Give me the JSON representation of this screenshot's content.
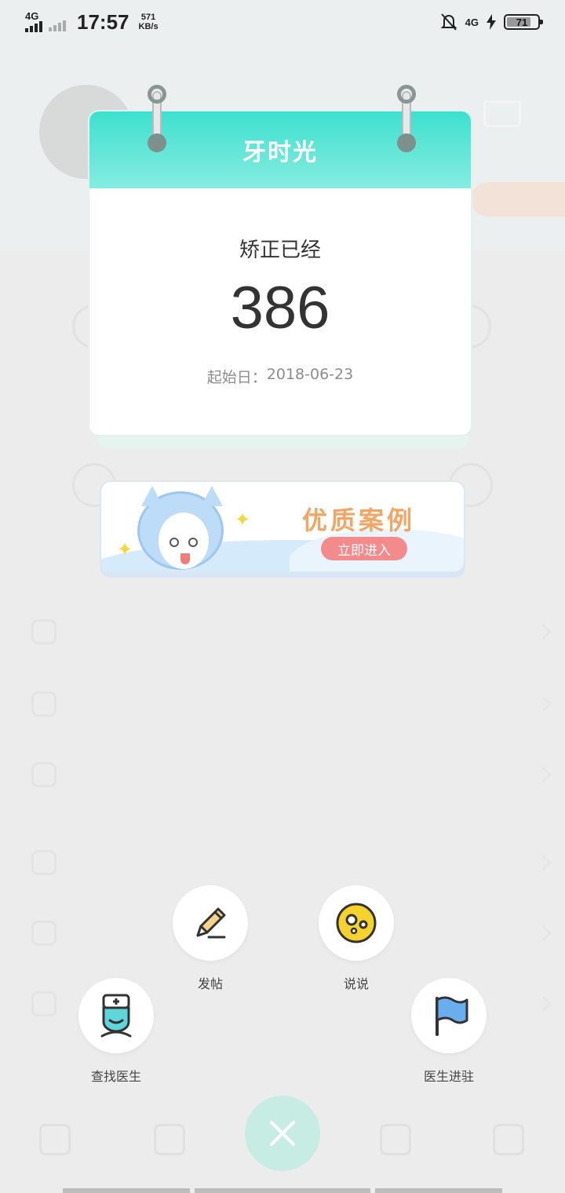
{
  "status_bar": {
    "network_left": "4G",
    "time": "17:57",
    "speed_value": "571",
    "speed_unit": "KB/s",
    "network_right": "4G",
    "battery": "71"
  },
  "calendar": {
    "title": "牙时光",
    "caption": "矫正已经",
    "days": "386",
    "start_label": "起始日：",
    "start_date": "2018-06-23"
  },
  "banner": {
    "title": "优质案例",
    "button": "立即进入"
  },
  "actions": {
    "post": "发帖",
    "say": "说说",
    "find_doctor": "查找医生",
    "doctor_join": "医生进驻"
  },
  "colors": {
    "accent": "#3ee0cf",
    "close_button": "#c6ece3",
    "banner_title": "#f3a565",
    "banner_button": "#f38b8c"
  },
  "icons": [
    "pencil-icon",
    "speech-bubble-icon",
    "nurse-doctor-icon",
    "flag-icon",
    "close-icon"
  ]
}
